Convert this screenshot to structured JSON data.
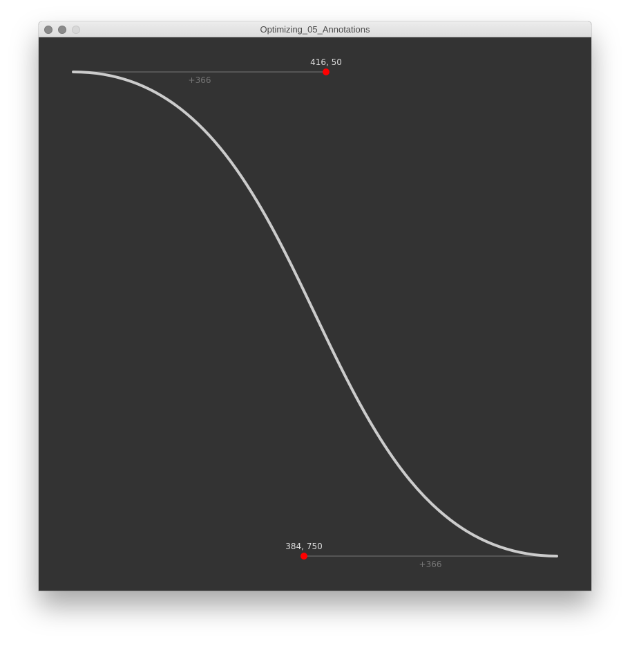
{
  "window": {
    "title": "Optimizing_05_Annotations"
  },
  "colors": {
    "background": "#333333",
    "curve": "#cccccc",
    "handle_line": "#555555",
    "handle_point": "#ff0000",
    "coord_label": "#dddddd",
    "offset_label": "#777777"
  },
  "annotations": {
    "control_top": {
      "coord_label": "416, 50",
      "offset_label": "+366"
    },
    "control_bottom": {
      "coord_label": "384, 750",
      "offset_label": "+366"
    }
  }
}
